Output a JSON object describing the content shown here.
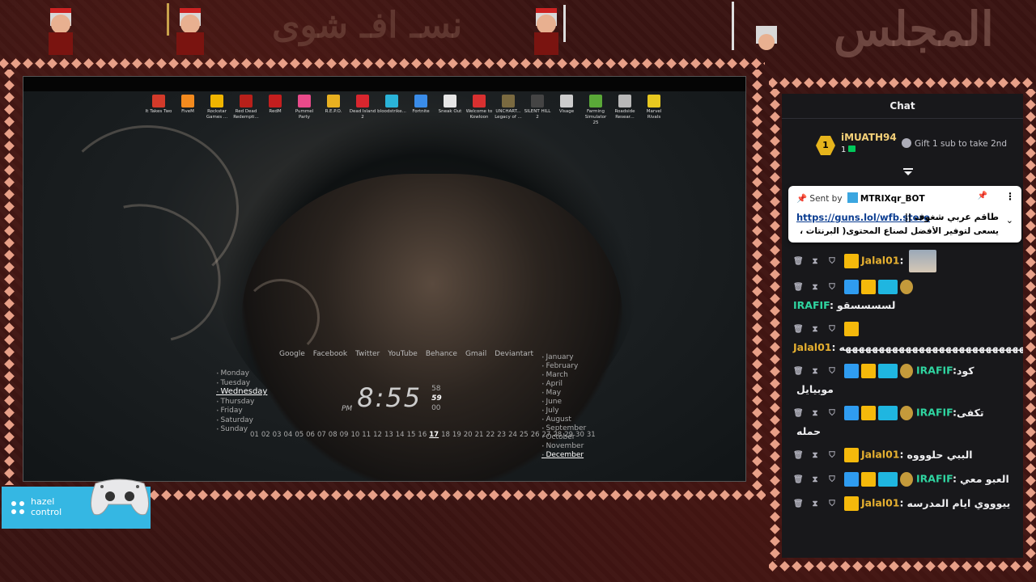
{
  "banner": {
    "title_left": "نسـ افـ شوى",
    "title_right": "المجلس"
  },
  "desktop": {
    "icons": [
      {
        "label": "It Takes Two",
        "color": "#d23a2a"
      },
      {
        "label": "FiveM",
        "color": "#f28a1e"
      },
      {
        "label": "Rockstar Games ...",
        "color": "#f0b500"
      },
      {
        "label": "Red Dead Redempti...",
        "color": "#b8201a"
      },
      {
        "label": "RedM",
        "color": "#c41e1e"
      },
      {
        "label": "Pummel Party",
        "color": "#e84a8a"
      },
      {
        "label": "R.E.P.O.",
        "color": "#e8b020"
      },
      {
        "label": "Dead Island 2",
        "color": "#d8262e"
      },
      {
        "label": "bloodstrike...",
        "color": "#2ab3d8"
      },
      {
        "label": "Fortnite",
        "color": "#3a8ce8"
      },
      {
        "label": "Sneak Out",
        "color": "#e6e6e6"
      },
      {
        "label": "Welcome to Kowloon",
        "color": "#d83030"
      },
      {
        "label": "UNCHART... Legacy of ...",
        "color": "#7a6a40"
      },
      {
        "label": "SILENT HILL 2",
        "color": "#444444"
      },
      {
        "label": "Visage",
        "color": "#cccccc"
      },
      {
        "label": "Farming Simulator 25",
        "color": "#5aa838"
      },
      {
        "label": "Roadside Resear...",
        "color": "#b8b8b8"
      },
      {
        "label": "Marvel Rivals",
        "color": "#e8c820"
      }
    ],
    "links": [
      "Google",
      "Facebook",
      "Twitter",
      "YouTube",
      "Behance",
      "Gmail",
      "Deviantart"
    ],
    "days": [
      "Monday",
      "Tuesday",
      "Wednesday",
      "Thursday",
      "Friday",
      "Saturday",
      "Sunday"
    ],
    "active_day": "Wednesday",
    "clock": {
      "period": "PM",
      "time": "8:55",
      "seconds": [
        "58",
        "59",
        "00"
      ]
    },
    "months": [
      "January",
      "February",
      "March",
      "April",
      "May",
      "June",
      "July",
      "August",
      "September",
      "October",
      "November",
      "December"
    ],
    "active_month": "December",
    "dates": [
      "01",
      "02",
      "03",
      "04",
      "05",
      "06",
      "07",
      "08",
      "09",
      "10",
      "11",
      "12",
      "13",
      "14",
      "15",
      "16",
      "17",
      "18",
      "19",
      "20",
      "21",
      "22",
      "23",
      "24",
      "25",
      "26",
      "27",
      "28",
      "29",
      "30",
      "31"
    ],
    "active_date": "17"
  },
  "hazel": {
    "line1": "hazel",
    "line2": "control"
  },
  "chat": {
    "title": "Chat",
    "leader": {
      "rank": "1",
      "name": "iMUATH94",
      "count": "1",
      "gift_note": "Gift 1 sub to take 2nd"
    },
    "pinned": {
      "sent_by_prefix": "Sent by",
      "sender": "MTRIXqr_BOT",
      "url": "https://guns.lol/wfb.store",
      "line1": "طاقم عربي شغوف ||",
      "line2": "يسعى لتوفير الأفضل لصناع المحتوى( البرنتات ، هويه ،..."
    },
    "messages": [
      {
        "user": "Jalal01",
        "text": "",
        "badges": [
          "crown"
        ],
        "has_image": true
      },
      {
        "user": "IRAFIF",
        "text": "لسسسسقو",
        "badges": [
          "hammer",
          "crown",
          "bg",
          "egg"
        ]
      },
      {
        "user": "Jalal01",
        "text": "هههههههههههههههههههههههههههههههههههههههههههههههههه",
        "badges": [
          "crown"
        ]
      },
      {
        "user": "IRAFIF",
        "text": "كود موبيايل",
        "badges": [
          "hammer",
          "crown",
          "bg",
          "egg"
        ]
      },
      {
        "user": "IRAFIF",
        "text": "تكفى حمله",
        "badges": [
          "hammer",
          "crown",
          "bg",
          "egg"
        ]
      },
      {
        "user": "Jalal01",
        "text": "الببي حلوووه",
        "badges": [
          "crown"
        ]
      },
      {
        "user": "IRAFIF",
        "text": "العبو معي",
        "badges": [
          "hammer",
          "crown",
          "bg",
          "egg"
        ]
      },
      {
        "user": "Jalal01",
        "text": "ييوووي ايام المدرسه",
        "badges": [
          "crown"
        ]
      }
    ]
  }
}
